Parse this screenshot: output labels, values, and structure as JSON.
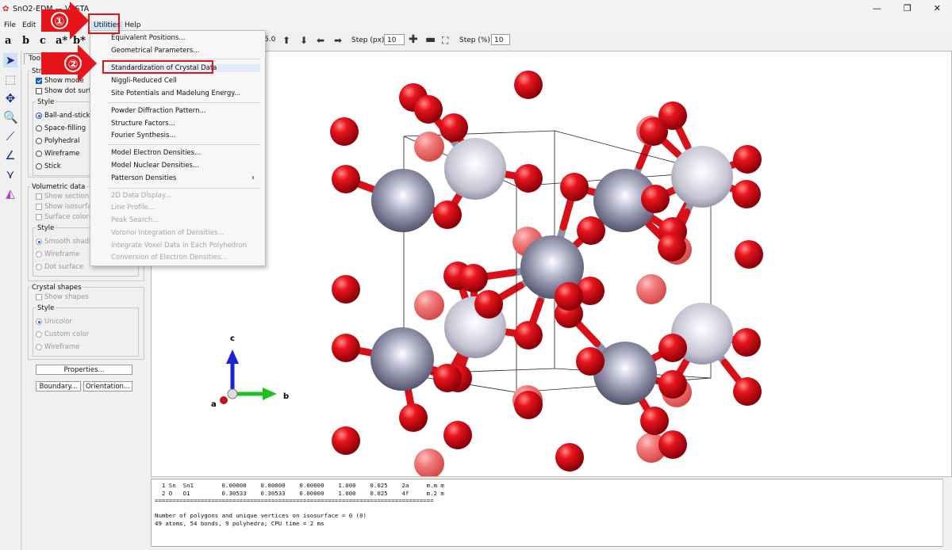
{
  "window": {
    "title": "SnO2-EDM — VESTA",
    "controls": [
      "—",
      "❐",
      "✕"
    ]
  },
  "menubar": [
    "File",
    "Edit",
    "V",
    "Utilities",
    "Help"
  ],
  "toolbar": {
    "axis_buttons": [
      "a",
      "b",
      "c",
      "a*",
      "b*"
    ],
    "rotation_value": "5.0",
    "step_px_label": "Step (px):",
    "step_px_value": "10",
    "step_pct_label": "Step (%):",
    "step_pct_value": "10"
  },
  "side_panel": {
    "tabs": [
      "Tools",
      "St"
    ],
    "structural_model": {
      "title": "Structura",
      "show_models": "Show mode",
      "show_dot_surface": "Show dot surfa",
      "style_title": "Style",
      "styles": [
        "Ball-and-stick",
        "Space-filling",
        "Polyhedral",
        "Wireframe",
        "Stick"
      ],
      "selected_style": "Ball-and-stick"
    },
    "volumetric_data": {
      "title": "Volumetric data",
      "options": [
        "Show sections",
        "Show isosurfac",
        "Surface colorin"
      ],
      "style_title": "Style",
      "styles": [
        "Smooth shadin",
        "Wireframe",
        "Dot surface"
      ]
    },
    "crystal_shapes": {
      "title": "Crystal shapes",
      "show_shapes": "Show shapes",
      "style_title": "Style",
      "styles": [
        "Unicolor",
        "Custom color",
        "Wireframe"
      ]
    },
    "buttons": {
      "properties": "Properties...",
      "boundary": "Boundary...",
      "orientation": "Orientation..."
    }
  },
  "utilities_menu": {
    "items": [
      {
        "label": "Equivalent Positions...",
        "enabled": true
      },
      {
        "label": "Geometrical Parameters...",
        "enabled": true
      },
      {
        "label": "Standardization of Crystal Data",
        "enabled": true,
        "highlighted": true
      },
      {
        "label": "Niggli-Reduced Cell",
        "enabled": true
      },
      {
        "label": "Site Potentials and Madelung Energy...",
        "enabled": true
      },
      {
        "label": "Powder Diffraction Pattern...",
        "enabled": true
      },
      {
        "label": "Structure Factors...",
        "enabled": true
      },
      {
        "label": "Fourier Synthesis...",
        "enabled": true
      },
      {
        "label": "Model Electron Densities...",
        "enabled": true
      },
      {
        "label": "Model Nuclear Densities...",
        "enabled": true
      },
      {
        "label": "Patterson Densities",
        "enabled": true,
        "submenu": true
      },
      {
        "label": "2D Data Display...",
        "enabled": false
      },
      {
        "label": "Line Profile...",
        "enabled": false
      },
      {
        "label": "Peak Search...",
        "enabled": false
      },
      {
        "label": "Voronoi Integration of Densities...",
        "enabled": false
      },
      {
        "label": "Integrate Voxel Data in Each Polyhedron",
        "enabled": false
      },
      {
        "label": "Conversion of Electron Densities...",
        "enabled": false
      }
    ]
  },
  "annotations": {
    "step1": "①",
    "step2": "②",
    "color": "#e8141c"
  },
  "viewport": {
    "axes": {
      "a": "a",
      "b": "b",
      "c": "c"
    },
    "colors": {
      "oxygen": "#e0141c",
      "tin": "#8f8fa8",
      "tin_light": "#c6c6d4"
    }
  },
  "console": {
    "lines": [
      "  1 Sn  Sn1        0.00000    0.00000    0.00000    1.000    0.025    2a     m.m m",
      "  2 O   O1         0.30533    0.30533    0.00000    1.000    0.025    4f     m.2 m",
      "===============================================================================",
      "",
      "Number of polygons and unique vertices on isosurface = 0 (0)",
      "49 atoms, 54 bonds, 9 polyhedra; CPU time = 2 ms"
    ]
  }
}
